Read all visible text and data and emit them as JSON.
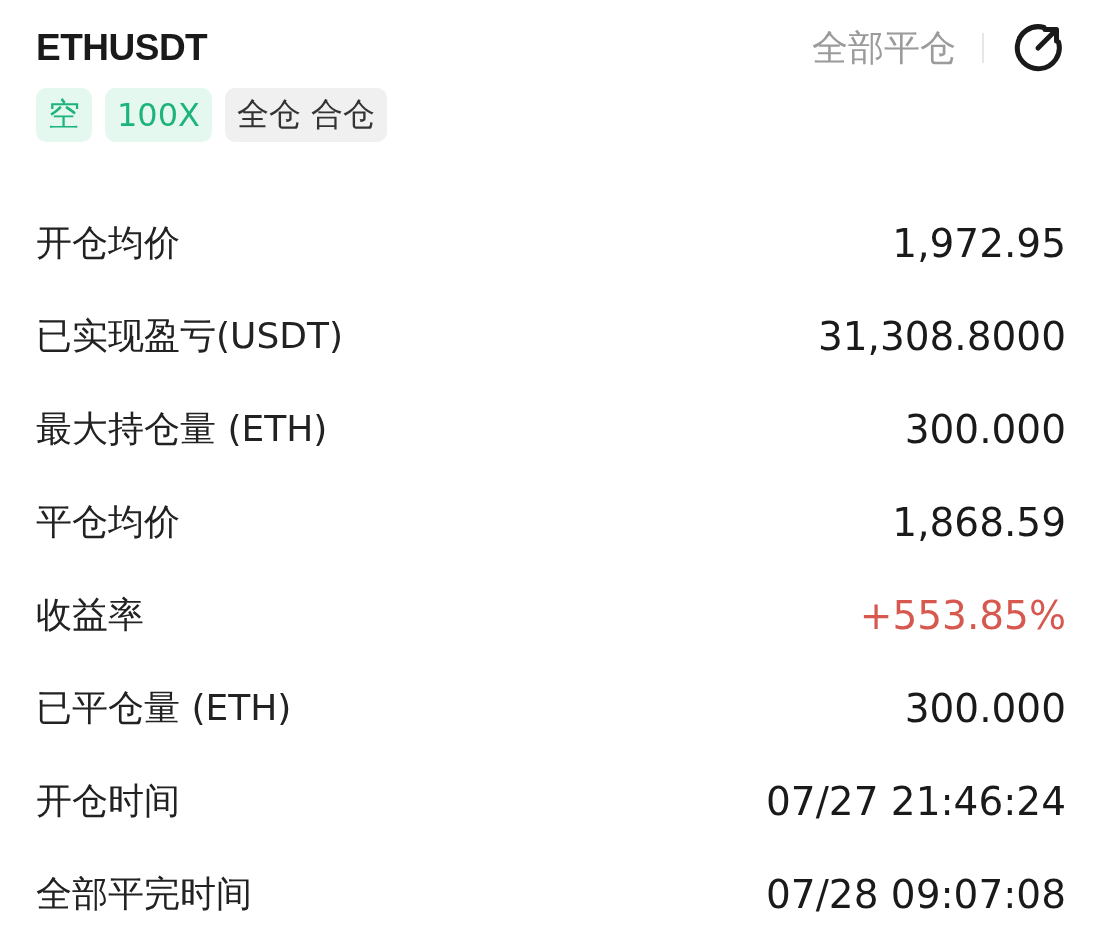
{
  "header": {
    "symbol": "ETHUSDT",
    "close_all": "全部平仓"
  },
  "tags": [
    {
      "label": "空",
      "kind": "side"
    },
    {
      "label": "100X",
      "kind": "leverage"
    },
    {
      "label": "全仓 合仓",
      "kind": "mode"
    }
  ],
  "rows": [
    {
      "label": "开仓均价",
      "value": "1,972.95",
      "kind": "plain"
    },
    {
      "label": "已实现盈亏(USDT)",
      "value": "31,308.8000",
      "kind": "plain"
    },
    {
      "label": "最大持仓量 (ETH)",
      "value": "300.000",
      "kind": "plain"
    },
    {
      "label": "平仓均价",
      "value": "1,868.59",
      "kind": "plain"
    },
    {
      "label": "收益率",
      "value": "+553.85%",
      "kind": "gain"
    },
    {
      "label": "已平仓量 (ETH)",
      "value": "300.000",
      "kind": "plain"
    },
    {
      "label": "开仓时间",
      "value": "07/27 21:46:24",
      "kind": "plain"
    },
    {
      "label": "全部平完时间",
      "value": "07/28 09:07:08",
      "kind": "plain"
    }
  ]
}
